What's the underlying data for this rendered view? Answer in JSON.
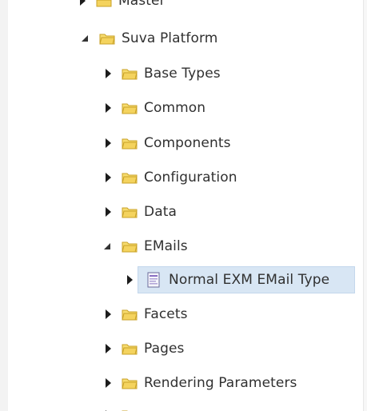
{
  "tree": {
    "root_partial_label": "Master",
    "platform": {
      "label": "Suva Platform",
      "children": [
        {
          "label": "Base Types"
        },
        {
          "label": "Common"
        },
        {
          "label": "Components"
        },
        {
          "label": "Configuration"
        },
        {
          "label": "Data"
        },
        {
          "label": "EMails"
        },
        {
          "label": "Normal EXM EMail Type"
        },
        {
          "label": "Facets"
        },
        {
          "label": "Pages"
        },
        {
          "label": "Rendering Parameters"
        }
      ]
    }
  },
  "colors": {
    "selection_background": "#d8e6f4",
    "folder_fill": "#f4d35e",
    "folder_stroke": "#c9a227"
  },
  "icons": {
    "expand_toggle": "caret-right-icon",
    "collapse_toggle": "caret-down-icon",
    "folder": "folder-icon",
    "template_item": "template-document-icon"
  }
}
